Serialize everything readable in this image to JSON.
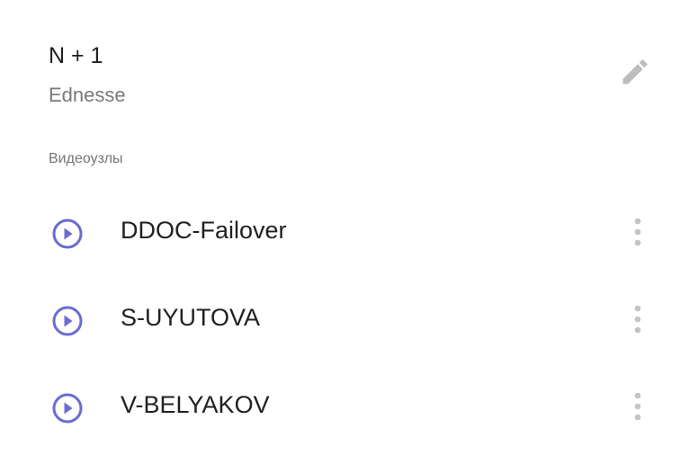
{
  "group": {
    "title": "N + 1",
    "subtitle": "Ednesse"
  },
  "icons": {
    "edit": "pencil-icon",
    "play": "play-circle-icon",
    "more": "more-vertical-icon"
  },
  "colors": {
    "accent": "#6a6bd3",
    "icon_muted": "#bdbdbd"
  },
  "section_label": "Видеоузлы",
  "nodes": [
    {
      "name": "DDOC-Failover"
    },
    {
      "name": "S-UYUTOVA"
    },
    {
      "name": "V-BELYAKOV"
    }
  ]
}
